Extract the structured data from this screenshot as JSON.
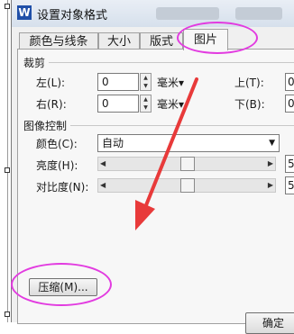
{
  "dialog": {
    "title": "设置对象格式",
    "app_icon_letter": "W"
  },
  "tabs": [
    {
      "label": "颜色与线条",
      "active": false
    },
    {
      "label": "大小",
      "active": false
    },
    {
      "label": "版式",
      "active": false
    },
    {
      "label": "图片",
      "active": true
    }
  ],
  "crop": {
    "group_label": "裁剪",
    "left": {
      "label": "左(L):",
      "value": "0",
      "unit": "毫米▾"
    },
    "right": {
      "label": "右(R):",
      "value": "0",
      "unit": "毫米▾"
    },
    "top": {
      "label": "上(T):",
      "value": "0"
    },
    "bottom": {
      "label": "下(B):",
      "value": "0"
    }
  },
  "image_control": {
    "group_label": "图像控制",
    "color": {
      "label": "颜色(C):",
      "value": "自动"
    },
    "brightness": {
      "label": "亮度(H):",
      "value_cut": "5",
      "level": 0.5
    },
    "contrast": {
      "label": "对比度(N):",
      "value_cut": "5",
      "level": 0.5
    }
  },
  "buttons": {
    "compress": "压缩(M)...",
    "ok": "确定"
  },
  "annotation": {
    "color": "#e23be0",
    "arrow_color": "#e83a3a"
  }
}
